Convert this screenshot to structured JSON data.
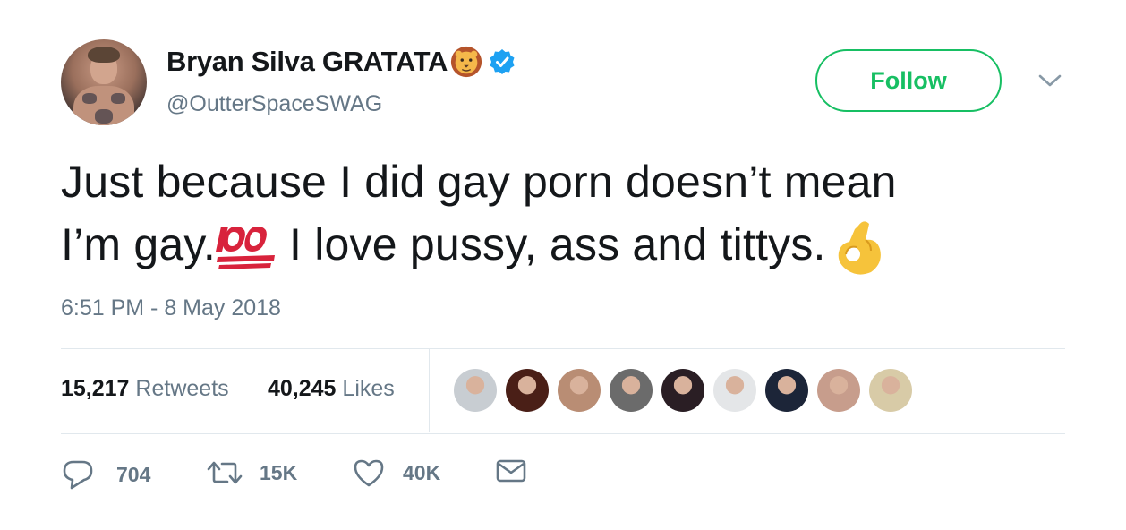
{
  "user": {
    "display_name": "Bryan Silva GRATATA",
    "handle": "@OutterSpaceSWAG",
    "name_emoji": "lion-face-icon",
    "verified": true
  },
  "follow_label": "Follow",
  "tweet": {
    "line1": "Just because I did gay porn doesn’t mean",
    "line2_a": "I’m gay.",
    "emoji_1": "hundred-points-icon",
    "line2_b": " I love pussy, ass and tittys.",
    "emoji_2": "ok-hand-icon"
  },
  "timestamp": "6:51 PM - 8 May 2018",
  "stats": {
    "retweets_count": "15,217",
    "retweets_label": "Retweets",
    "likes_count": "40,245",
    "likes_label": "Likes"
  },
  "liker_avatars": [
    {
      "color": "#c8cdd2"
    },
    {
      "color": "#4a1f17"
    },
    {
      "color": "#b98d74"
    },
    {
      "color": "#6b6b6b"
    },
    {
      "color": "#2a1e24"
    },
    {
      "color": "#e4e6e8"
    },
    {
      "color": "#1c2538"
    },
    {
      "color": "#c79d8c"
    },
    {
      "color": "#d8cba7"
    }
  ],
  "actions": {
    "replies": "704",
    "retweets": "15K",
    "likes": "40K"
  },
  "colors": {
    "follow_green": "#17bf63",
    "secondary_text": "#657786",
    "verified_blue": "#1da1f2",
    "primary_text": "#14171a"
  }
}
